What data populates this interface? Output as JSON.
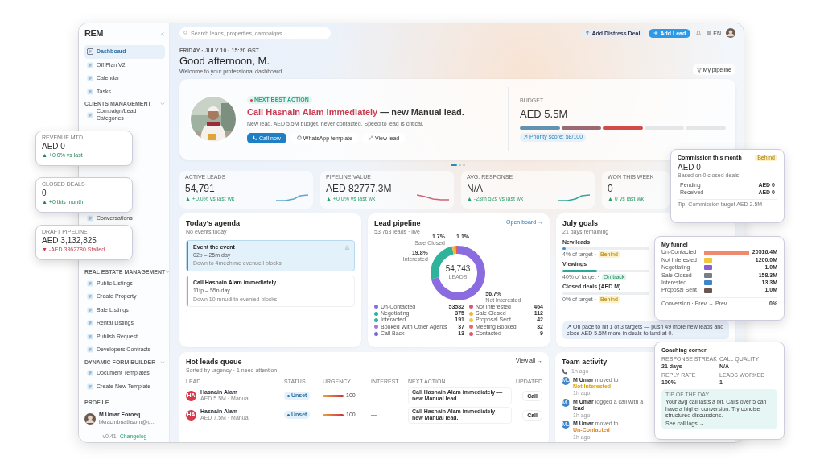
{
  "sidebar": {
    "logo": "REM",
    "groups": [
      {
        "items": [
          {
            "label": "Dashboard",
            "selected": true
          },
          {
            "label": "Off Plan V2",
            "selected": false
          },
          {
            "label": "Calendar",
            "selected": false
          },
          {
            "label": "Tasks",
            "selected": false
          }
        ]
      },
      {
        "title": "CLIENTS MANAGEMENT",
        "items": [
          {
            "label": "Compaign/Lead Categories",
            "selected": false
          }
        ]
      },
      {
        "items": [
          {
            "label": "Conversations",
            "selected": false
          }
        ]
      },
      {
        "title": "REAL ESTATE MANAGEMENT",
        "items": [
          {
            "label": "Public Listings",
            "selected": false
          },
          {
            "label": "Create Property",
            "selected": false
          },
          {
            "label": "Sale Listings",
            "selected": false
          },
          {
            "label": "Rental Listings",
            "selected": false
          },
          {
            "label": "Publish Request",
            "selected": false
          },
          {
            "label": "Developers Contracts",
            "selected": false
          }
        ]
      },
      {
        "title": "DYNAMIC FORM BUILDER",
        "items": [
          {
            "label": "Document Templates",
            "selected": false
          },
          {
            "label": "Create New Template",
            "selected": false
          }
        ]
      }
    ],
    "profile": {
      "title": "PROFILE",
      "name": "M Umar Foroeq",
      "email": "bkracinbnathsom@g..."
    },
    "version": "v0.41",
    "changelog": "Changelog"
  },
  "header": {
    "search": {
      "placeholder": "Search leads, properties, campaigns..."
    },
    "distress_button": "Add Distress Deal",
    "add_button": "Add Lead",
    "language": "EN"
  },
  "greeting": {
    "date": "FRIDAY · JULY 10 · 15:20 GST",
    "title": "Good afternoon, M.",
    "subtitle": "Welcome to your professional dashboard.",
    "pipeline_button": "My pipeline"
  },
  "hero": {
    "badge": "NEXT BEST ACTION",
    "title_highlight": "Call Hasnain Alam immediately",
    "title_rest": "— new Manual lead.",
    "description": "New lead, AED 5.5M budget, never contacted. Speed to lead is critical.",
    "actions": [
      {
        "kind": "primary",
        "label": "Call now"
      },
      {
        "kind": "whatsapp",
        "label": "WhatsApp template"
      },
      {
        "kind": "link",
        "label": "View lead"
      }
    ],
    "budget_label": "BUDGET",
    "budget": "AED 5.5M",
    "budget_segments": [
      {
        "color": "#5f92b3"
      },
      {
        "color": "#9a6a72"
      },
      {
        "color": "#d24b4b"
      },
      {
        "color": "#e4e6ea"
      },
      {
        "color": "#e4e6ea"
      }
    ],
    "priority": "Priority score: 58/100"
  },
  "carousel": [
    {
      "selected": true
    },
    {
      "selected": false
    },
    {
      "selected": false
    }
  ],
  "stats": [
    {
      "label": "ACTIVE LEADS",
      "value": "54,791",
      "change": "▲ +0.0% vs last wk",
      "color": "#5aa9c9"
    },
    {
      "label": "PIPELINE VALUE",
      "value": "AED 82777.3M",
      "change": "▲ +0.0% vs last wk",
      "color": "#d2607a"
    },
    {
      "label": "AVG. RESPONSE",
      "value": "N/A",
      "change": "▲ -23m 52s vs last wk",
      "color": "#2fa89a"
    },
    {
      "label": "WON THIS WEEK",
      "value": "0",
      "change": "▲ 0 vs last wk"
    }
  ],
  "agenda": {
    "title": "Today's agenda",
    "subtitle": "No events today",
    "events": [
      {
        "title": "Event the event",
        "time": "02p – 25m day",
        "note": "Down to 4mechime evenuell blocks",
        "color": "#3a8fd0",
        "selected": true
      },
      {
        "title": "Call Hasnain Alam immediately",
        "time": "11tp – 55n day",
        "note": "Down 10 mnudiltn evenied blocks",
        "color": "#e39a5a",
        "selected": false
      }
    ]
  },
  "pipeline": {
    "title": "Lead pipeline",
    "subtitle": "53,763 leads · live",
    "link": "Open board →",
    "center_value": "54,743",
    "center_label": "LEADS",
    "chart_data": {
      "type": "donut",
      "categories": [
        "Not Interested",
        "Interested",
        "Sale Closed",
        null
      ],
      "values": [
        56.7,
        19.8,
        1.7,
        1.1
      ],
      "value_labels": [
        "56.7%",
        "19.8%",
        "1.7%",
        "1.1%"
      ]
    },
    "legend": [
      {
        "name": "Un-Contacted",
        "count": "53582",
        "color": "#8b6be0"
      },
      {
        "name": "Not Interested",
        "count": "464",
        "color": "#d9577a"
      },
      {
        "name": "Negotiating",
        "count": "375",
        "color": "#2fb39a"
      },
      {
        "name": "Sale Closed",
        "count": "112",
        "color": "#f2b640"
      },
      {
        "name": "Interacted",
        "count": "191",
        "color": "#3bb3a0"
      },
      {
        "name": "Proposal Sent",
        "count": "42",
        "color": "#f0c94a"
      },
      {
        "name": "Booked With Other Agents",
        "count": "37",
        "color": "#9a7fd6"
      },
      {
        "name": "Meeting Booked",
        "count": "32",
        "color": "#e86a6a"
      },
      {
        "name": "Call Back",
        "count": "13",
        "color": "#7d66d8"
      },
      {
        "name": "Contacted",
        "count": "9",
        "color": "#e05a6a"
      }
    ]
  },
  "goals": {
    "title": "July goals",
    "subtitle": "21 days remaining",
    "items": [
      {
        "label": "New leads",
        "level": 0.04,
        "note": "4% of target ·",
        "status": "Behind",
        "kind": "behind"
      },
      {
        "label": "Viewings",
        "level": 0.4,
        "note": "40% of target ·",
        "status": "On track",
        "kind": "on-track"
      },
      {
        "label": "Closed deals (AED M)",
        "note": "0% of target ·",
        "status": "Behind",
        "kind": "behind"
      }
    ],
    "tip": "↗ On pace to hit 1 of 3 targets — push 49 more new leads and close AED 5.5M more in deals to land at 0."
  },
  "hot_leads": {
    "title": "Hot leads queue",
    "subtitle": "Sorted by urgency · 1 need attention",
    "link": "View all →",
    "columns": [
      "LEAD",
      "STATUS",
      "URGENCY",
      "INTEREST",
      "NEXT ACTION",
      "UPDATED"
    ],
    "rows": [
      {
        "initials": "HA",
        "name": "Hasnain Alam",
        "detail": "AED 5.5M · Manual",
        "status": "Unset",
        "level": 1,
        "urgency": "100",
        "interest": "—",
        "next_action": "Call Hasnain Alam immediately — new Manual lead.",
        "button": "Call"
      },
      {
        "initials": "HA",
        "name": "Hasnain Alam",
        "detail": "AED 7.5M · Manual",
        "status": "Unset",
        "level": 1,
        "urgency": "100",
        "interest": "—",
        "next_action": "Call Hasnain Alam immediately — new Manual lead.",
        "button": "Call"
      }
    ]
  },
  "team": {
    "title": "Team activity",
    "items": [
      {
        "time": "1h ago"
      },
      {
        "initials": "MU",
        "actor": "M Umar",
        "action": "moved to",
        "target": "Not Interested",
        "color": "#d9a400",
        "time": "1h ago"
      },
      {
        "initials": "MU",
        "actor": "M Umar",
        "action": "logged a call with a",
        "target": "lead",
        "time": "1h ago"
      },
      {
        "initials": "MU",
        "actor": "M Umar",
        "action": "moved to",
        "target": "Un-Contacted",
        "color": "#e0892a",
        "time": "1h ago"
      }
    ]
  },
  "float_left": [
    {
      "label": "REVENUE MTD",
      "value": "AED 0",
      "change": "▲ +0.0% vs last",
      "kind": "up"
    },
    {
      "label": "CLOSED DEALS",
      "value": "0",
      "change": "▲ +0 this month",
      "kind": "up"
    },
    {
      "label": "DRAFT PIPELINE",
      "value": "AED 3,132,825",
      "change": "▼ -AED 3362780 Stalled",
      "kind": "down"
    }
  ],
  "commission": {
    "title": "Commission this month",
    "badge": "Behind",
    "value": "AED 0",
    "subtitle": "Based on 0 closed deals",
    "rows": [
      {
        "label": "Pending",
        "value": "AED 0"
      },
      {
        "label": "Received",
        "value": "AED 0"
      }
    ],
    "footer": "Tip: Commission target AED 2.5M"
  },
  "funnel": {
    "title": "My funnel",
    "rows": [
      {
        "label": "Un-Contacted",
        "value": "20516.4M",
        "color": "#ef8a6e"
      },
      {
        "label": "Not Interested",
        "value": "1200.0M",
        "color": "#f2c53d"
      },
      {
        "label": "Negotiating",
        "value": "1.0M",
        "color": "#8a5cd6"
      },
      {
        "label": "Sale Closed",
        "value": "158.3M",
        "color": "#7a7f86"
      },
      {
        "label": "Interested",
        "value": "13.3M",
        "color": "#3f86c9"
      },
      {
        "label": "Proposal Sent",
        "value": "1.0M",
        "color": "#6b5750"
      }
    ],
    "footer": "Conversion · Prev → Prev",
    "footer_value": "0%"
  },
  "coaching": {
    "title": "Coaching corner",
    "metrics": [
      {
        "label": "RESPONSE STREAK",
        "value": "21 days"
      },
      {
        "label": "CALL QUALITY",
        "value": "N/A"
      },
      {
        "label": "REPLY RATE",
        "value": "100%"
      },
      {
        "label": "LEADS WORKED",
        "value": "1"
      }
    ],
    "tip_title": "TIP OF THE DAY",
    "tip": "Your avg call lasts a bit. Calls over 5 can have a higher conversion. Try concise structured discussions.",
    "tip_link": "See call logs →"
  }
}
